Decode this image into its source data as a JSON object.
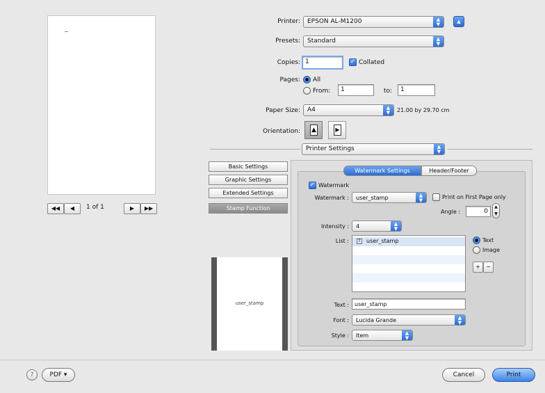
{
  "preview": {
    "page_counter": "1 of 1",
    "first_label": "◀◀",
    "prev_label": "◀",
    "next_label": "▶",
    "last_label": "▶▶"
  },
  "printer": {
    "label": "Printer:",
    "value": "EPSON AL-M1200"
  },
  "presets": {
    "label": "Presets:",
    "value": "Standard"
  },
  "copies": {
    "label": "Copies:",
    "value": "1",
    "collated_label": "Collated",
    "collated": true
  },
  "pages": {
    "label": "Pages:",
    "all_label": "All",
    "from_label": "From:",
    "from_value": "1",
    "to_label": "to:",
    "to_value": "1"
  },
  "paper_size": {
    "label": "Paper Size:",
    "value": "A4",
    "dimensions": "21.00 by 29.70 cm"
  },
  "orientation": {
    "label": "Orientation:"
  },
  "panel_popup": "Printer Settings",
  "side_tabs": [
    "Basic Settings",
    "Graphic Settings",
    "Extended Settings",
    "Stamp Function"
  ],
  "stamp_preview_text": "user_stamp",
  "subtabs": [
    "Watermark Settings",
    "Header/Footer"
  ],
  "watermark": {
    "enable_label": "Watermark",
    "enabled": true,
    "select_label": "Watermark :",
    "select_value": "user_stamp",
    "first_page_label": "Print on First Page only",
    "angle_label": "Angle :",
    "angle_value": "0",
    "intensity_label": "Intensity :",
    "intensity_value": "4",
    "list_label": "List :",
    "list_items": [
      "user_stamp"
    ],
    "text_radio_label": "Text",
    "image_radio_label": "Image",
    "add_label": "+",
    "remove_label": "−",
    "text_label": "Text :",
    "text_value": "user_stamp",
    "font_label": "Font :",
    "font_value": "Lucida Grande",
    "style_label": "Style :",
    "style_value": "Item"
  },
  "footer": {
    "help_label": "?",
    "pdf_label": "PDF ▾",
    "cancel_label": "Cancel",
    "print_label": "Print"
  },
  "colors": {
    "accent": "#3d84e6",
    "panel": "#d6d6d6",
    "selected_tab": "#8a8a8a"
  }
}
